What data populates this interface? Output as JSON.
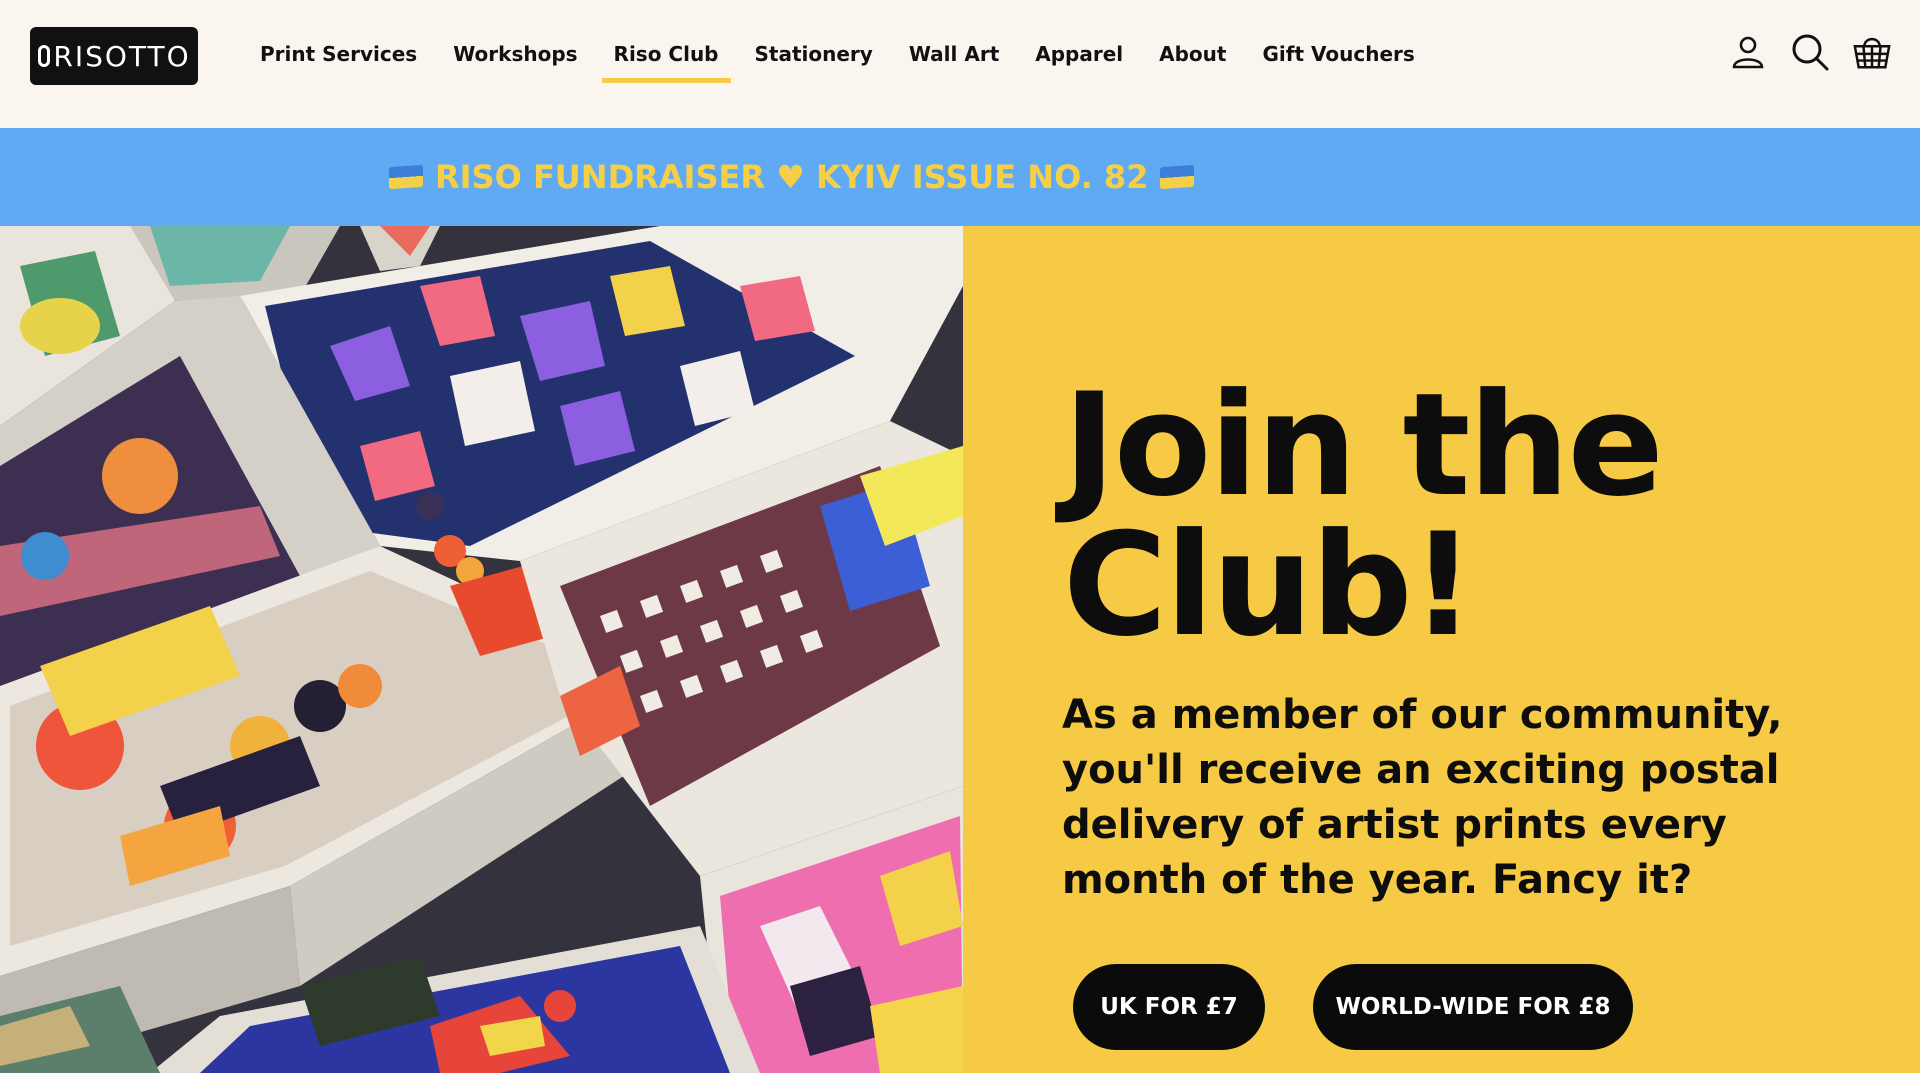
{
  "header": {
    "logo_text": "RISOTTO",
    "nav": [
      {
        "label": "Print Services"
      },
      {
        "label": "Workshops"
      },
      {
        "label": "Riso Club",
        "active": true
      },
      {
        "label": "Stationery"
      },
      {
        "label": "Wall Art"
      },
      {
        "label": "Apparel"
      },
      {
        "label": "About"
      },
      {
        "label": "Gift Vouchers"
      }
    ],
    "icons": [
      "account-icon",
      "search-icon",
      "basket-icon"
    ]
  },
  "banner": {
    "text": "RISO FUNDRAISER ♥ KYIV ISSUE NO. 82"
  },
  "hero": {
    "title_line1": "Join the",
    "title_line2": "Club!",
    "description": "As a member of our community, you'll receive an exciting postal delivery of artist prints every month of the year. Fancy it?",
    "buttons": [
      {
        "label": "UK FOR £7"
      },
      {
        "label": "WORLD-WIDE FOR £8"
      }
    ]
  },
  "colors": {
    "background": "#faf5ef",
    "banner": "#60aaf4",
    "banner_text": "#f5cf46",
    "accent_yellow": "#f6ca45",
    "nav_underline": "#f4cb4b",
    "button": "#0b0b0b"
  }
}
